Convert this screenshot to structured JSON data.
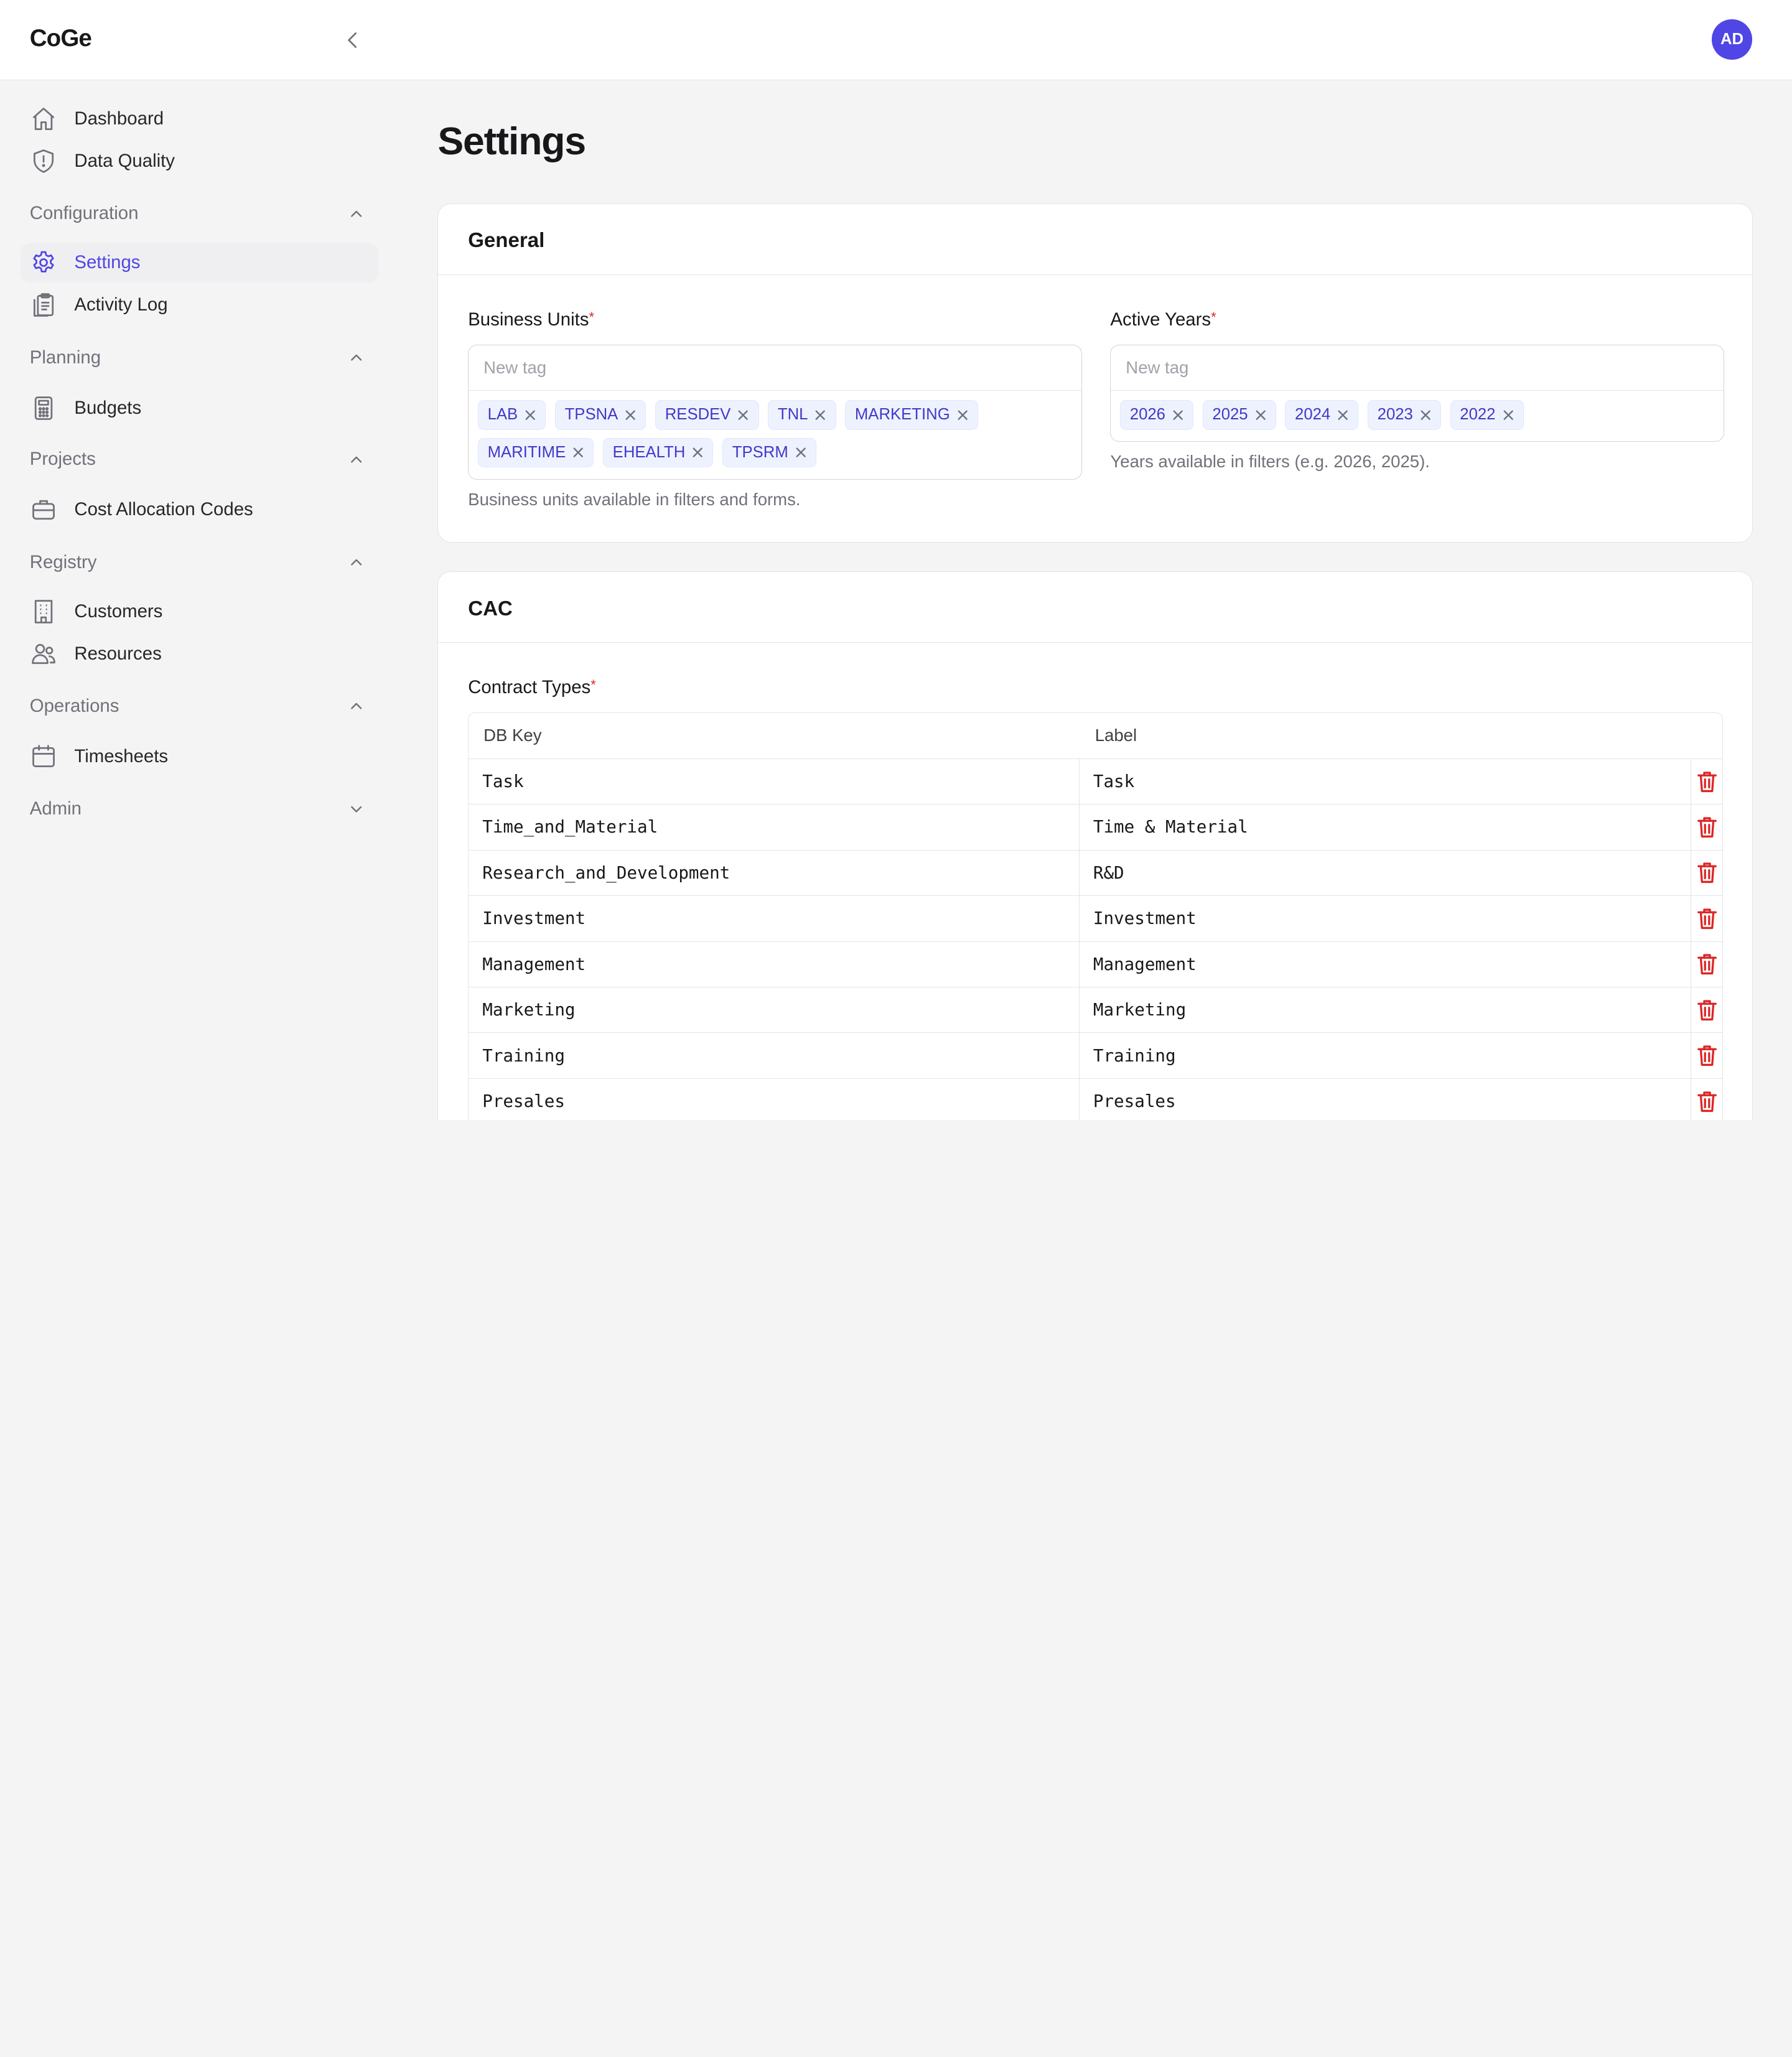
{
  "header": {
    "brand": "CoGe",
    "avatar_initials": "AD"
  },
  "sidebar": {
    "top_items": [
      {
        "label": "Dashboard",
        "icon": "home-icon"
      },
      {
        "label": "Data Quality",
        "icon": "shield-alert-icon"
      }
    ],
    "sections": [
      {
        "label": "Configuration",
        "expanded": true,
        "items": [
          {
            "label": "Settings",
            "icon": "gear-icon",
            "active": true
          },
          {
            "label": "Activity Log",
            "icon": "clipboard-icon"
          }
        ]
      },
      {
        "label": "Planning",
        "expanded": true,
        "items": [
          {
            "label": "Budgets",
            "icon": "calculator-icon"
          }
        ]
      },
      {
        "label": "Projects",
        "expanded": true,
        "items": [
          {
            "label": "Cost Allocation Codes",
            "icon": "briefcase-icon"
          }
        ]
      },
      {
        "label": "Registry",
        "expanded": true,
        "items": [
          {
            "label": "Customers",
            "icon": "building-icon"
          },
          {
            "label": "Resources",
            "icon": "users-icon"
          }
        ]
      },
      {
        "label": "Operations",
        "expanded": true,
        "items": [
          {
            "label": "Timesheets",
            "icon": "calendar-icon"
          }
        ]
      },
      {
        "label": "Admin",
        "expanded": false,
        "items": []
      }
    ]
  },
  "main": {
    "title": "Settings",
    "general": {
      "title": "General",
      "business_units": {
        "label": "Business Units",
        "required_mark": "*",
        "placeholder": "New tag",
        "tags": [
          "LAB",
          "TPSNA",
          "RESDEV",
          "TNL",
          "MARKETING",
          "MARITIME",
          "EHEALTH",
          "TPSRM"
        ],
        "helper": "Business units available in filters and forms."
      },
      "active_years": {
        "label": "Active Years",
        "required_mark": "*",
        "placeholder": "New tag",
        "tags": [
          "2026",
          "2025",
          "2024",
          "2023",
          "2022"
        ],
        "helper": "Years available in filters (e.g. 2026, 2025)."
      }
    },
    "cac": {
      "title": "CAC",
      "contract_types": {
        "label": "Contract Types",
        "required_mark": "*",
        "columns": [
          "DB Key",
          "Label"
        ],
        "rows": [
          {
            "key": "Task",
            "label": "Task"
          },
          {
            "key": "Time_and_Material",
            "label": "Time & Material"
          },
          {
            "key": "Research_and_Development",
            "label": "R&D"
          },
          {
            "key": "Investment",
            "label": "Investment"
          },
          {
            "key": "Management",
            "label": "Management"
          },
          {
            "key": "Marketing",
            "label": "Marketing"
          },
          {
            "key": "Training",
            "label": "Training"
          },
          {
            "key": "Presales",
            "label": "Presales"
          }
        ]
      }
    }
  },
  "colors": {
    "accent": "#4f46e5",
    "danger": "#dc2626",
    "tag_bg": "#eef2ff",
    "tag_text": "#4338ca"
  }
}
